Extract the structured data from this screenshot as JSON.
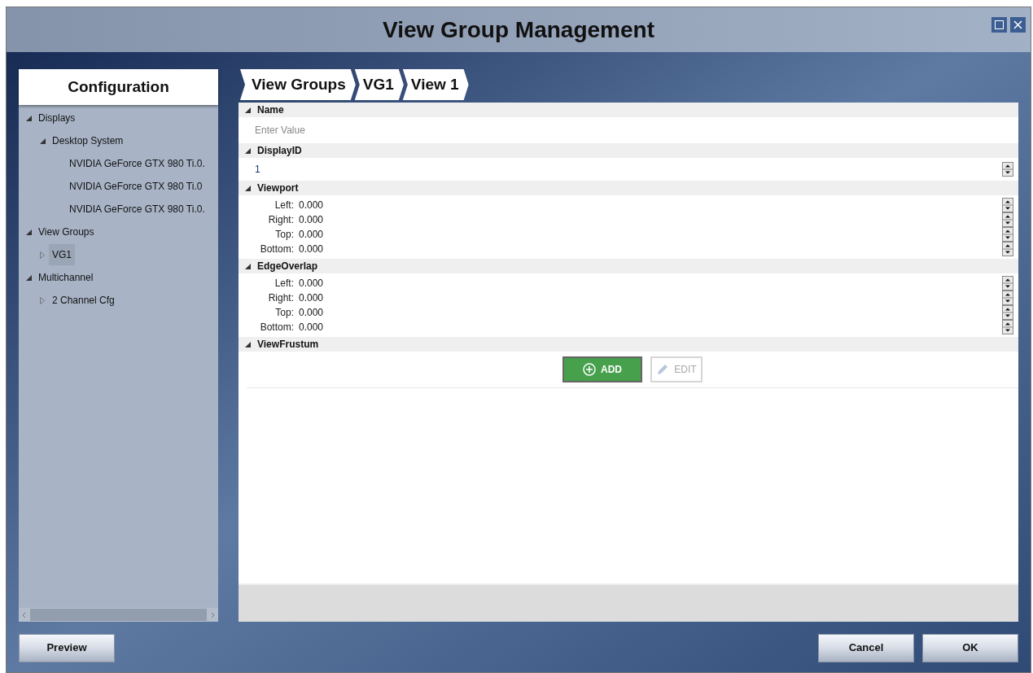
{
  "window": {
    "title": "View Group Management"
  },
  "sidebar": {
    "title": "Configuration",
    "tree": [
      {
        "label": "Displays",
        "expanded": true,
        "selected": false,
        "children": [
          {
            "label": "Desktop System",
            "expanded": true,
            "selected": false,
            "children": [
              {
                "label": "NVIDIA GeForce GTX 980 Ti.0.",
                "selected": false
              },
              {
                "label": "NVIDIA GeForce GTX 980 Ti.0",
                "selected": false
              },
              {
                "label": "NVIDIA GeForce GTX 980 Ti.0.",
                "selected": false
              }
            ]
          }
        ]
      },
      {
        "label": "View Groups",
        "expanded": true,
        "selected": false,
        "children": [
          {
            "label": "VG1",
            "expanded": false,
            "selected": true
          }
        ]
      },
      {
        "label": "Multichannel",
        "expanded": true,
        "selected": false,
        "children": [
          {
            "label": "2 Channel Cfg",
            "expanded": false,
            "selected": false
          }
        ]
      }
    ]
  },
  "breadcrumbs": [
    "View Groups",
    "VG1",
    "View 1"
  ],
  "properties": [
    {
      "kind": "text",
      "title": "Name",
      "expanded": true,
      "placeholder": "Enter Value"
    },
    {
      "kind": "number",
      "title": "DisplayID",
      "expanded": true,
      "value": "1"
    },
    {
      "kind": "fields",
      "title": "Viewport",
      "expanded": true,
      "fields": [
        {
          "label": "Left:",
          "value": "0.000"
        },
        {
          "label": "Right:",
          "value": "0.000"
        },
        {
          "label": "Top:",
          "value": "0.000"
        },
        {
          "label": "Bottom:",
          "value": "0.000"
        }
      ]
    },
    {
      "kind": "fields",
      "title": "EdgeOverlap",
      "expanded": true,
      "fields": [
        {
          "label": "Left:",
          "value": "0.000"
        },
        {
          "label": "Right:",
          "value": "0.000"
        },
        {
          "label": "Top:",
          "value": "0.000"
        },
        {
          "label": "Bottom:",
          "value": "0.000"
        }
      ]
    },
    {
      "kind": "actions",
      "title": "ViewFrustum",
      "expanded": true,
      "buttons": [
        {
          "kind": "add",
          "label": "ADD",
          "disabled": false
        },
        {
          "kind": "edit",
          "label": "EDIT",
          "disabled": true
        }
      ]
    }
  ],
  "footer_buttons": {
    "left": [
      "Preview"
    ],
    "right": [
      "Cancel",
      "OK"
    ]
  }
}
